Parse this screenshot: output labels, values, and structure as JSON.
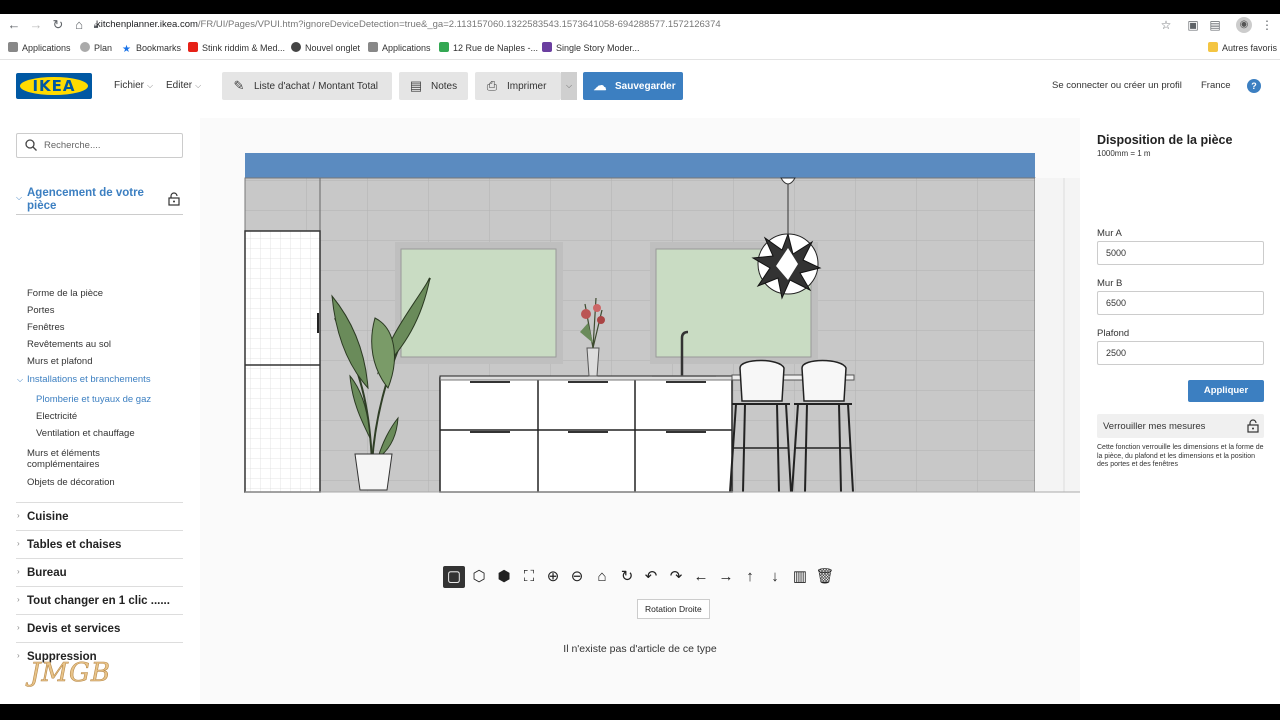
{
  "browser": {
    "url_host": "kitchenplanner.ikea.com",
    "url_path": "/FR/UI/Pages/VPUI.htm?ignoreDeviceDetection=true&_ga=2.113157060.1322583543.1573641058-694288577.1572126374",
    "bookmarks": [
      "Applications",
      "Plan",
      "Bookmarks",
      "Stink riddim & Med...",
      "Nouvel onglet",
      "Applications",
      "12 Rue de Naples -...",
      "Single Story Moder...",
      "Autres favoris"
    ]
  },
  "header": {
    "logo_text": "IKEA",
    "menu_file": "Fichier",
    "menu_edit": "Editer",
    "btn_shopping": "Liste d'achat / Montant Total",
    "btn_notes": "Notes",
    "btn_print": "Imprimer",
    "btn_save": "Sauvegarder",
    "signin": "Se connecter ou créer un profil",
    "country": "France",
    "help": "?"
  },
  "sidebar": {
    "search_placeholder": "Recherche....",
    "section_title": "Agencement de votre pièce",
    "items": [
      "Forme de la pièce",
      "Portes",
      "Fenêtres",
      "Revêtements au sol",
      "Murs et plafond",
      "Installations et branchements",
      "Plomberie et tuyaux de gaz",
      "Electricité",
      "Ventilation et chauffage",
      "Murs et éléments complémentaires",
      "Objets de décoration"
    ],
    "categories": [
      "Cuisine",
      "Tables et chaises",
      "Bureau",
      "Tout changer en 1 clic ......",
      "Devis et services",
      "Suppression"
    ],
    "watermark": "JMGB"
  },
  "canvas": {
    "tooltip": "Rotation Droite",
    "empty_message": "Il n'existe pas d'article de ce type",
    "tools": [
      "square-view-icon",
      "3d-box-icon",
      "3d-solid-icon",
      "zoom-fit-icon",
      "zoom-in-icon",
      "zoom-out-icon",
      "home-icon",
      "rotate-icon",
      "rotate-left-icon",
      "rotate-right-icon",
      "arrow-left-icon",
      "arrow-right-icon",
      "arrow-up-icon",
      "arrow-down-icon",
      "floorplan-icon",
      "trash-icon"
    ]
  },
  "room_panel": {
    "title": "Disposition de la pièce",
    "scale": "1000mm = 1 m",
    "wall_a_label": "Mur A",
    "wall_a_value": "5000",
    "wall_b_label": "Mur B",
    "wall_b_value": "6500",
    "ceiling_label": "Plafond",
    "ceiling_value": "2500",
    "apply": "Appliquer",
    "lock_label": "Verrouiller mes mesures",
    "lock_desc": "Cette fonction verrouille les dimensions et la forme de la pièce, du plafond et les dimensions et la position des portes et des fenêtres"
  }
}
